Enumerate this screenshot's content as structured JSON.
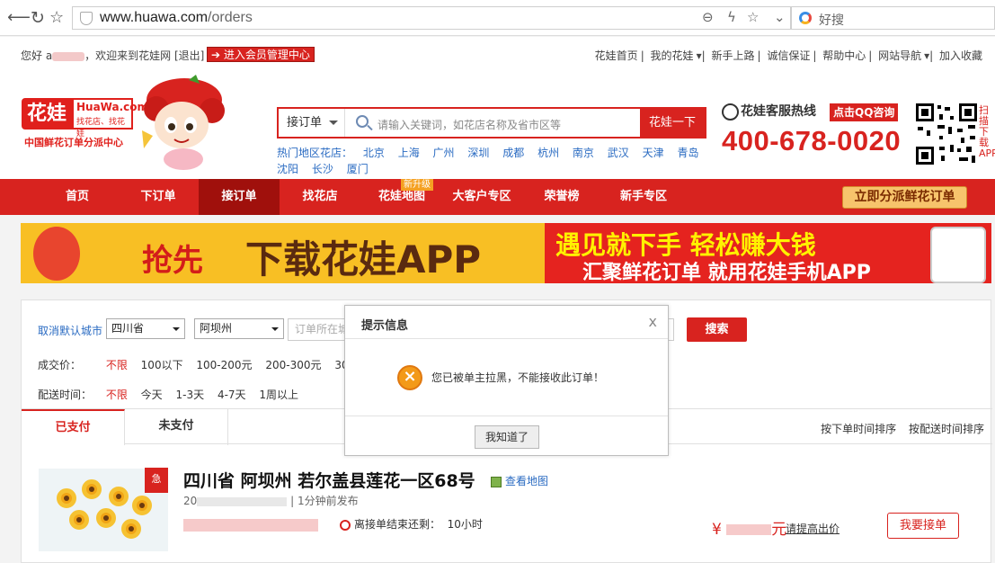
{
  "browser": {
    "url_host": "www.huawa.com",
    "url_path": "/orders",
    "search_placeholder": "好搜"
  },
  "topbar": {
    "greeting_prefix": "您好 a",
    "greeting_suffix": "，欢迎来到花娃网 [退出]",
    "member_button": "进入会员管理中心",
    "links": [
      "花娃首页",
      "我的花娃",
      "新手上路",
      "诚信保证",
      "帮助中心",
      "网站导航",
      "加入收藏"
    ]
  },
  "header": {
    "logo_cn": "花娃",
    "logo_en": "HuaWa.com",
    "logo_slogan": "找花店、找花娃",
    "logo_sub": "中国鲜花订单分派中心",
    "search_select": "接订单",
    "search_placeholder": "请输入关键词，如花店名称及省市区等",
    "search_button": "花娃一下",
    "hot_label": "热门地区花店：",
    "hot_cities": [
      "北京",
      "上海",
      "广州",
      "深圳",
      "成都",
      "杭州",
      "南京",
      "武汉",
      "天津",
      "青岛",
      "沈阳",
      "长沙",
      "厦门"
    ],
    "hotline_label": "花娃客服热线",
    "qq_button": "点击QQ咨询",
    "phone": "400-678-0020",
    "scan_text": "扫描下载APP"
  },
  "nav": {
    "items": [
      "首页",
      "下订单",
      "接订单",
      "找花店",
      "花娃地图",
      "大客户专区",
      "荣誉榜",
      "新手专区"
    ],
    "new_badge": "新升级",
    "dispatch_button": "立即分派鲜花订单"
  },
  "banner": {
    "rush": "抢先",
    "download": "下载花娃APP",
    "line1": "遇见就下手 轻松赚大钱",
    "line2": "汇聚鲜花订单 就用花娃手机APP"
  },
  "filters": {
    "cancel_default": "取消默认城市",
    "province": "四川省",
    "city": "阿坝州",
    "address_placeholder": "订单所在城",
    "search_button": "搜索",
    "price_label": "成交价：",
    "price_options": [
      "不限",
      "100以下",
      "100-200元",
      "200-300元",
      "300-4"
    ],
    "delivery_label": "配送时间：",
    "delivery_options": [
      "不限",
      "今天",
      "1-3天",
      "4-7天",
      "1周以上"
    ]
  },
  "tabs": {
    "paid": "已支付",
    "unpaid": "未支付",
    "sort_order_time": "按下单时间排序",
    "sort_delivery_time": "按配送时间排序"
  },
  "order": {
    "urgent": "急",
    "title": "四川省 阿坝州 若尔盖县莲花一区68号",
    "map_link": "查看地图",
    "meta_prefix": "20",
    "meta_suffix": " | 1分钟前发布",
    "countdown_label": "离接单结束还剩：",
    "countdown_value": "10小时",
    "currency": "¥",
    "price_unit": "元",
    "higher_link": "请提高出价",
    "accept_button": "我要接单"
  },
  "modal": {
    "title": "提示信息",
    "close": "x",
    "message": "您已被单主拉黑，不能接收此订单！",
    "ok_button": "我知道了"
  }
}
